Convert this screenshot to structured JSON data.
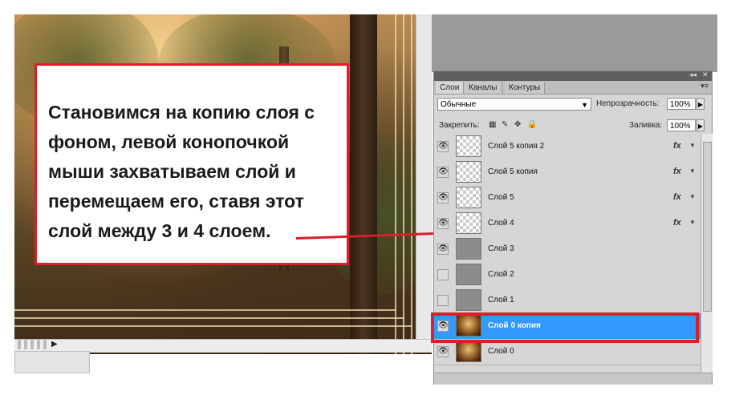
{
  "annotation": {
    "text": "Становимся на копию слоя с фоном, левой конопочкой мыши захватываем слой и перемещаем его, ставя этот слой между 3 и 4 слоем."
  },
  "panel": {
    "tabs": [
      {
        "label": "Слои"
      },
      {
        "label": "Каналы"
      },
      {
        "label": "Контуры"
      }
    ],
    "blend_mode": "Обычные",
    "opacity_label": "Непрозрачность:",
    "opacity_value": "100%",
    "lock_label": "Закрепить:",
    "fill_label": "Заливка:",
    "fill_value": "100%"
  },
  "layers": [
    {
      "name": "Слой 5 копия 2",
      "visible": true,
      "thumb": "checker",
      "fx": "fx"
    },
    {
      "name": "Слой 5 копия",
      "visible": true,
      "thumb": "checker",
      "fx": "fx"
    },
    {
      "name": "Слой 5",
      "visible": true,
      "thumb": "checker",
      "fx": "fx"
    },
    {
      "name": "Слой 4",
      "visible": true,
      "thumb": "figure",
      "fx": "fx"
    },
    {
      "name": "Слой 3",
      "visible": true,
      "thumb": "gray",
      "fx": ""
    },
    {
      "name": "Слой 2",
      "visible": false,
      "thumb": "gray",
      "fx": ""
    },
    {
      "name": "Слой 1",
      "visible": false,
      "thumb": "gray",
      "fx": ""
    },
    {
      "name": "Слой 0 копия",
      "visible": true,
      "thumb": "photo",
      "fx": "",
      "selected": true
    },
    {
      "name": "Слой 0",
      "visible": true,
      "thumb": "photo",
      "fx": ""
    }
  ],
  "colors": {
    "accent_red": "#e01e2a",
    "selection_blue": "#3399ff"
  }
}
